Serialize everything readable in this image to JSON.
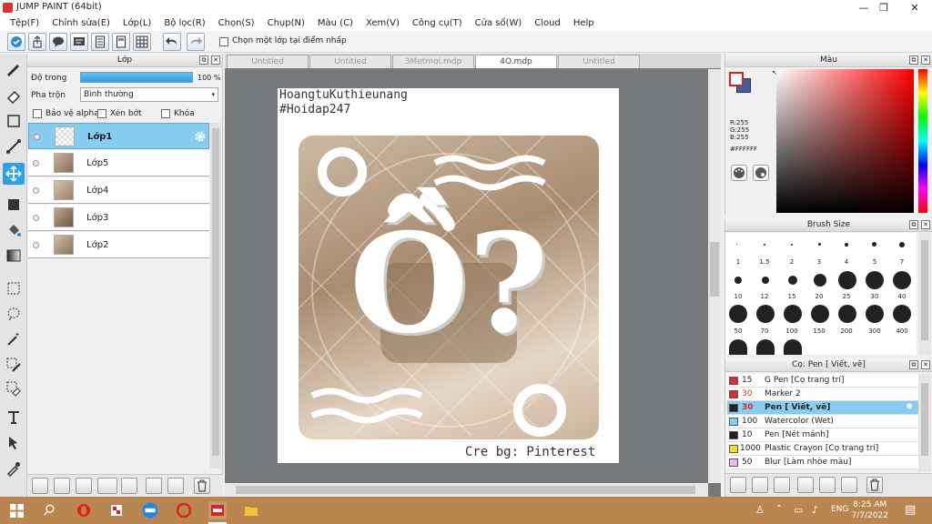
{
  "window": {
    "title": "JUMP PAINT (64bit)"
  },
  "menu": [
    "Tệp(F)",
    "Chỉnh sửa(E)",
    "Lớp(L)",
    "Bộ lọc(R)",
    "Chọn(S)",
    "Chụp(N)",
    "Màu (C)",
    "Xem(V)",
    "Công cụ(T)",
    "Cửa sổ(W)",
    "Cloud",
    "Help"
  ],
  "toolbar": {
    "select_layer_label": "Chọn một lớp tại điểm nhấp"
  },
  "layer_panel": {
    "title": "Lớp",
    "opacity_label": "Độ trong",
    "opacity_value": "100 %",
    "opacity_percent": 100,
    "blend_label": "Pha trộn",
    "blend_value": "Bình thường",
    "protect_alpha": "Bảo vệ alpha",
    "clipping": "Xén bớt",
    "lock": "Khóa",
    "layers": [
      "Lớp1",
      "Lớp5",
      "Lớp4",
      "Lớp3",
      "Lớp2"
    ]
  },
  "tabs": [
    "Untitled",
    "Untitled",
    "3Metmoi.mdp",
    "4O.mdp",
    "Untitled"
  ],
  "canvas": {
    "line1": "HoangtuKuthieunang",
    "line2": "#Hoidap247",
    "credit": "Cre bg: Pinterest",
    "art_text": "Ồ?"
  },
  "color_panel": {
    "title": "Màu",
    "r": "R:255",
    "g": "G:255",
    "b": "B:255",
    "hex": "#FFFFFF"
  },
  "brush_size": {
    "title": "Brush Size",
    "sizes": [
      "1",
      "1.5",
      "2",
      "3",
      "4",
      "5",
      "7",
      "10",
      "12",
      "15",
      "20",
      "25",
      "30",
      "40",
      "50",
      "70",
      "100",
      "150",
      "200",
      "300",
      "400"
    ]
  },
  "brush_list": {
    "title": "Cọ: Pen [ Viết, vẽ]",
    "items": [
      {
        "size": "15",
        "name": "G Pen [Cọ trang trí]",
        "color": "#e8272a"
      },
      {
        "size": "30",
        "name": "Marker 2",
        "color": "#e8272a"
      },
      {
        "size": "30",
        "name": "Pen [ Viết, vẽ]",
        "color": "#222222"
      },
      {
        "size": "100",
        "name": "Watercolor (Wet)",
        "color": "#7fd3f0"
      },
      {
        "size": "10",
        "name": "Pen [Nét mảnh]",
        "color": "#222222"
      },
      {
        "size": "1000",
        "name": "Plastic Crayon [Cọ trang trí]",
        "color": "#f4e01c"
      },
      {
        "size": "50",
        "name": "Blur [Làm nhòe màu]",
        "color": "#f3b7e8"
      }
    ]
  },
  "taskbar": {
    "lang": "ENG",
    "time": "8:25 AM",
    "date": "7/7/2022"
  }
}
